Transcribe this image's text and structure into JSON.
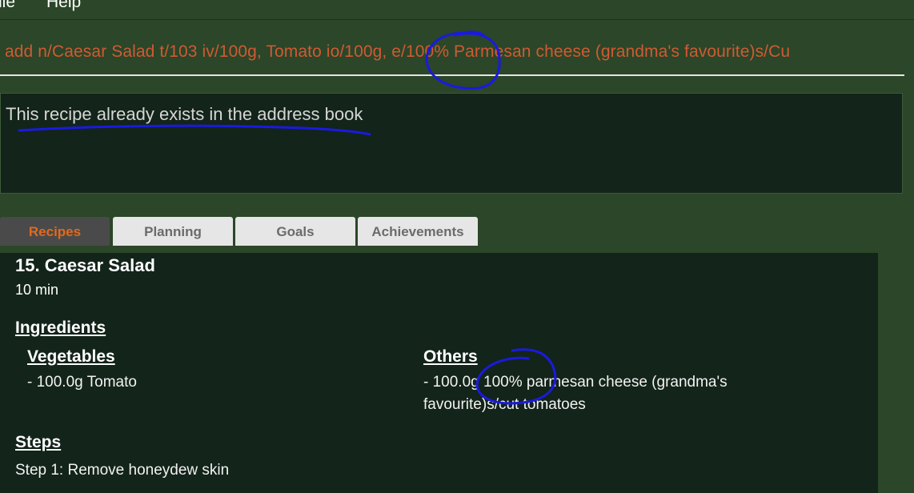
{
  "menu": {
    "file": "ile",
    "help": "Help"
  },
  "command_input": {
    "value": "add n/Caesar Salad t/103 iv/100g, Tomato io/100g, e/100% Parmesan cheese (grandma's favourite)s/Cu"
  },
  "result": {
    "message": "This recipe already exists in the address book"
  },
  "tabs": [
    {
      "label": "Recipes"
    },
    {
      "label": "Planning"
    },
    {
      "label": "Goals"
    },
    {
      "label": "Achievements"
    }
  ],
  "recipe": {
    "title": "15.  Caesar Salad",
    "time": "10 min",
    "ingredients_heading": "Ingredients",
    "vegetables_heading": "Vegetables",
    "vegetables_line": "- 100.0g Tomato",
    "others_heading": "Others",
    "others_line1": "- 100.0g 100% parmesan cheese (grandma's",
    "others_line2": "favourite)s/cut tomatoes",
    "steps_heading": "Steps",
    "step1": "Step 1: Remove honeydew skin"
  },
  "colors": {
    "background": "#2b4628",
    "panel": "#13241a",
    "command_text": "#d05a33",
    "selected_tab_text": "#e06a1e",
    "annotation_ink": "#1a1ae0"
  }
}
